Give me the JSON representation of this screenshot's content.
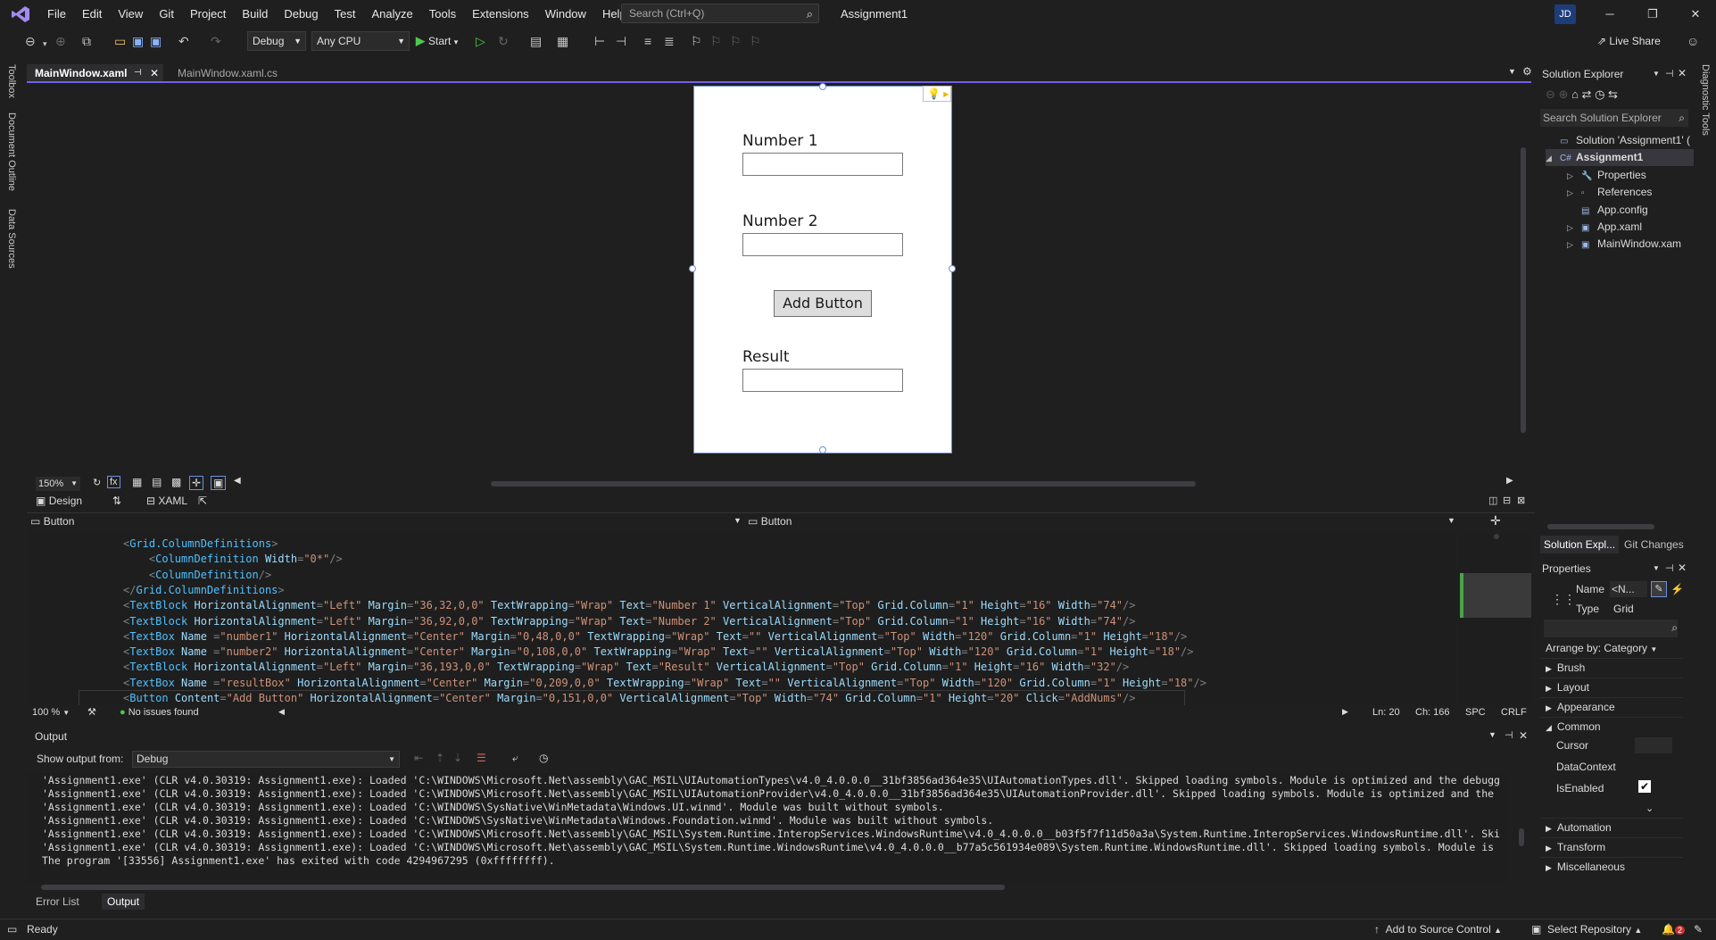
{
  "menubar": {
    "items": [
      "File",
      "Edit",
      "View",
      "Git",
      "Project",
      "Build",
      "Debug",
      "Test",
      "Analyze",
      "Tools",
      "Extensions",
      "Window",
      "Help"
    ],
    "search_placeholder": "Search (Ctrl+Q)",
    "window_title": "Assignment1",
    "user_initials": "JD"
  },
  "toolbar": {
    "config": "Debug",
    "platform": "Any CPU",
    "start_label": "Start",
    "live_share": "Live Share"
  },
  "left_rail": [
    "Toolbox",
    "Document Outline",
    "Data Sources"
  ],
  "right_rail": [
    "Diagnostic Tools"
  ],
  "tabs": [
    {
      "label": "MainWindow.xaml",
      "active": true
    },
    {
      "label": "MainWindow.xaml.cs",
      "active": false
    }
  ],
  "designer": {
    "number1_label": "Number 1",
    "number2_label": "Number 2",
    "button_label": "Add Button",
    "result_label": "Result",
    "zoom": "150%",
    "view_design": "Design",
    "view_xaml": "XAML",
    "breadcrumb_left": "Button",
    "breadcrumb_right": "Button"
  },
  "code_lines": [
    [
      [
        "p",
        "<"
      ],
      [
        "e",
        "Grid.ColumnDefinitions"
      ],
      [
        "p",
        ">"
      ]
    ],
    [
      [
        "p",
        "    <"
      ],
      [
        "e",
        "ColumnDefinition"
      ],
      [
        "a",
        " Width"
      ],
      [
        "p",
        "="
      ],
      [
        "v",
        "\"0*\""
      ],
      [
        "p",
        "/>"
      ]
    ],
    [
      [
        "p",
        "    <"
      ],
      [
        "e",
        "ColumnDefinition"
      ],
      [
        "p",
        "/>"
      ]
    ],
    [
      [
        "p",
        "</"
      ],
      [
        "e",
        "Grid.ColumnDefinitions"
      ],
      [
        "p",
        ">"
      ]
    ],
    [
      [
        "p",
        "<"
      ],
      [
        "e",
        "TextBlock"
      ],
      [
        "a",
        " HorizontalAlignment"
      ],
      [
        "p",
        "="
      ],
      [
        "v",
        "\"Left\""
      ],
      [
        "a",
        " Margin"
      ],
      [
        "p",
        "="
      ],
      [
        "v",
        "\"36,32,0,0\""
      ],
      [
        "a",
        " TextWrapping"
      ],
      [
        "p",
        "="
      ],
      [
        "v",
        "\"Wrap\""
      ],
      [
        "a",
        " Text"
      ],
      [
        "p",
        "="
      ],
      [
        "v",
        "\"Number 1\""
      ],
      [
        "a",
        " VerticalAlignment"
      ],
      [
        "p",
        "="
      ],
      [
        "v",
        "\"Top\""
      ],
      [
        "a",
        " Grid.Column"
      ],
      [
        "p",
        "="
      ],
      [
        "v",
        "\"1\""
      ],
      [
        "a",
        " Height"
      ],
      [
        "p",
        "="
      ],
      [
        "v",
        "\"16\""
      ],
      [
        "a",
        " Width"
      ],
      [
        "p",
        "="
      ],
      [
        "v",
        "\"74\""
      ],
      [
        "p",
        "/>"
      ]
    ],
    [
      [
        "p",
        "<"
      ],
      [
        "e",
        "TextBlock"
      ],
      [
        "a",
        " HorizontalAlignment"
      ],
      [
        "p",
        "="
      ],
      [
        "v",
        "\"Left\""
      ],
      [
        "a",
        " Margin"
      ],
      [
        "p",
        "="
      ],
      [
        "v",
        "\"36,92,0,0\""
      ],
      [
        "a",
        " TextWrapping"
      ],
      [
        "p",
        "="
      ],
      [
        "v",
        "\"Wrap\""
      ],
      [
        "a",
        " Text"
      ],
      [
        "p",
        "="
      ],
      [
        "v",
        "\"Number 2\""
      ],
      [
        "a",
        " VerticalAlignment"
      ],
      [
        "p",
        "="
      ],
      [
        "v",
        "\"Top\""
      ],
      [
        "a",
        " Grid.Column"
      ],
      [
        "p",
        "="
      ],
      [
        "v",
        "\"1\""
      ],
      [
        "a",
        " Height"
      ],
      [
        "p",
        "="
      ],
      [
        "v",
        "\"16\""
      ],
      [
        "a",
        " Width"
      ],
      [
        "p",
        "="
      ],
      [
        "v",
        "\"74\""
      ],
      [
        "p",
        "/>"
      ]
    ],
    [
      [
        "p",
        "<"
      ],
      [
        "e",
        "TextBox"
      ],
      [
        "a",
        " Name"
      ],
      [
        "p",
        " ="
      ],
      [
        "v",
        "\"number1\""
      ],
      [
        "a",
        " HorizontalAlignment"
      ],
      [
        "p",
        "="
      ],
      [
        "v",
        "\"Center\""
      ],
      [
        "a",
        " Margin"
      ],
      [
        "p",
        "="
      ],
      [
        "v",
        "\"0,48,0,0\""
      ],
      [
        "a",
        " TextWrapping"
      ],
      [
        "p",
        "="
      ],
      [
        "v",
        "\"Wrap\""
      ],
      [
        "a",
        " Text"
      ],
      [
        "p",
        "="
      ],
      [
        "v",
        "\"\""
      ],
      [
        "a",
        " VerticalAlignment"
      ],
      [
        "p",
        "="
      ],
      [
        "v",
        "\"Top\""
      ],
      [
        "a",
        " Width"
      ],
      [
        "p",
        "="
      ],
      [
        "v",
        "\"120\""
      ],
      [
        "a",
        " Grid.Column"
      ],
      [
        "p",
        "="
      ],
      [
        "v",
        "\"1\""
      ],
      [
        "a",
        " Height"
      ],
      [
        "p",
        "="
      ],
      [
        "v",
        "\"18\""
      ],
      [
        "p",
        "/>"
      ]
    ],
    [
      [
        "p",
        "<"
      ],
      [
        "e",
        "TextBox"
      ],
      [
        "a",
        " Name"
      ],
      [
        "p",
        " ="
      ],
      [
        "v",
        "\"number2\""
      ],
      [
        "a",
        " HorizontalAlignment"
      ],
      [
        "p",
        "="
      ],
      [
        "v",
        "\"Center\""
      ],
      [
        "a",
        " Margin"
      ],
      [
        "p",
        "="
      ],
      [
        "v",
        "\"0,108,0,0\""
      ],
      [
        "a",
        " TextWrapping"
      ],
      [
        "p",
        "="
      ],
      [
        "v",
        "\"Wrap\""
      ],
      [
        "a",
        " Text"
      ],
      [
        "p",
        "="
      ],
      [
        "v",
        "\"\""
      ],
      [
        "a",
        " VerticalAlignment"
      ],
      [
        "p",
        "="
      ],
      [
        "v",
        "\"Top\""
      ],
      [
        "a",
        " Width"
      ],
      [
        "p",
        "="
      ],
      [
        "v",
        "\"120\""
      ],
      [
        "a",
        " Grid.Column"
      ],
      [
        "p",
        "="
      ],
      [
        "v",
        "\"1\""
      ],
      [
        "a",
        " Height"
      ],
      [
        "p",
        "="
      ],
      [
        "v",
        "\"18\""
      ],
      [
        "p",
        "/>"
      ]
    ],
    [
      [
        "p",
        "<"
      ],
      [
        "e",
        "TextBlock"
      ],
      [
        "a",
        " HorizontalAlignment"
      ],
      [
        "p",
        "="
      ],
      [
        "v",
        "\"Left\""
      ],
      [
        "a",
        " Margin"
      ],
      [
        "p",
        "="
      ],
      [
        "v",
        "\"36,193,0,0\""
      ],
      [
        "a",
        " TextWrapping"
      ],
      [
        "p",
        "="
      ],
      [
        "v",
        "\"Wrap\""
      ],
      [
        "a",
        " Text"
      ],
      [
        "p",
        "="
      ],
      [
        "v",
        "\"Result\""
      ],
      [
        "a",
        " VerticalAlignment"
      ],
      [
        "p",
        "="
      ],
      [
        "v",
        "\"Top\""
      ],
      [
        "a",
        " Grid.Column"
      ],
      [
        "p",
        "="
      ],
      [
        "v",
        "\"1\""
      ],
      [
        "a",
        " Height"
      ],
      [
        "p",
        "="
      ],
      [
        "v",
        "\"16\""
      ],
      [
        "a",
        " Width"
      ],
      [
        "p",
        "="
      ],
      [
        "v",
        "\"32\""
      ],
      [
        "p",
        "/>"
      ]
    ],
    [
      [
        "p",
        "<"
      ],
      [
        "e",
        "TextBox"
      ],
      [
        "a",
        " Name"
      ],
      [
        "p",
        " ="
      ],
      [
        "v",
        "\"resultBox\""
      ],
      [
        "a",
        " HorizontalAlignment"
      ],
      [
        "p",
        "="
      ],
      [
        "v",
        "\"Center\""
      ],
      [
        "a",
        " Margin"
      ],
      [
        "p",
        "="
      ],
      [
        "v",
        "\"0,209,0,0\""
      ],
      [
        "a",
        " TextWrapping"
      ],
      [
        "p",
        "="
      ],
      [
        "v",
        "\"Wrap\""
      ],
      [
        "a",
        " Text"
      ],
      [
        "p",
        "="
      ],
      [
        "v",
        "\"\""
      ],
      [
        "a",
        " VerticalAlignment"
      ],
      [
        "p",
        "="
      ],
      [
        "v",
        "\"Top\""
      ],
      [
        "a",
        " Width"
      ],
      [
        "p",
        "="
      ],
      [
        "v",
        "\"120\""
      ],
      [
        "a",
        " Grid.Column"
      ],
      [
        "p",
        "="
      ],
      [
        "v",
        "\"1\""
      ],
      [
        "a",
        " Height"
      ],
      [
        "p",
        "="
      ],
      [
        "v",
        "\"18\""
      ],
      [
        "p",
        "/>"
      ]
    ],
    [
      [
        "p",
        "<"
      ],
      [
        "e",
        "Button"
      ],
      [
        "a",
        " Content"
      ],
      [
        "p",
        "="
      ],
      [
        "v",
        "\"Add Button\""
      ],
      [
        "a",
        " HorizontalAlignment"
      ],
      [
        "p",
        "="
      ],
      [
        "v",
        "\"Center\""
      ],
      [
        "a",
        " Margin"
      ],
      [
        "p",
        "="
      ],
      [
        "v",
        "\"0,151,0,0\""
      ],
      [
        "a",
        " VerticalAlignment"
      ],
      [
        "p",
        "="
      ],
      [
        "v",
        "\"Top\""
      ],
      [
        "a",
        " Width"
      ],
      [
        "p",
        "="
      ],
      [
        "v",
        "\"74\""
      ],
      [
        "a",
        " Grid.Column"
      ],
      [
        "p",
        "="
      ],
      [
        "v",
        "\"1\""
      ],
      [
        "a",
        " Height"
      ],
      [
        "p",
        "="
      ],
      [
        "v",
        "\"20\""
      ],
      [
        "a",
        " Click"
      ],
      [
        "p",
        "="
      ],
      [
        "v",
        "\"AddNums\""
      ],
      [
        "p",
        "/>"
      ]
    ]
  ],
  "code_status": {
    "zoom": "100 %",
    "issues": "No issues found",
    "line": "Ln: 20",
    "col": "Ch: 166",
    "spc": "SPC",
    "eol": "CRLF"
  },
  "output": {
    "title": "Output",
    "show_from_label": "Show output from:",
    "source": "Debug",
    "lines": [
      "'Assignment1.exe' (CLR v4.0.30319: Assignment1.exe): Loaded 'C:\\WINDOWS\\Microsoft.Net\\assembly\\GAC_MSIL\\UIAutomationTypes\\v4.0_4.0.0.0__31bf3856ad364e35\\UIAutomationTypes.dll'. Skipped loading symbols. Module is optimized and the debugg",
      "'Assignment1.exe' (CLR v4.0.30319: Assignment1.exe): Loaded 'C:\\WINDOWS\\Microsoft.Net\\assembly\\GAC_MSIL\\UIAutomationProvider\\v4.0_4.0.0.0__31bf3856ad364e35\\UIAutomationProvider.dll'. Skipped loading symbols. Module is optimized and the",
      "'Assignment1.exe' (CLR v4.0.30319: Assignment1.exe): Loaded 'C:\\WINDOWS\\SysNative\\WinMetadata\\Windows.UI.winmd'. Module was built without symbols.",
      "'Assignment1.exe' (CLR v4.0.30319: Assignment1.exe): Loaded 'C:\\WINDOWS\\SysNative\\WinMetadata\\Windows.Foundation.winmd'. Module was built without symbols.",
      "'Assignment1.exe' (CLR v4.0.30319: Assignment1.exe): Loaded 'C:\\WINDOWS\\Microsoft.Net\\assembly\\GAC_MSIL\\System.Runtime.InteropServices.WindowsRuntime\\v4.0_4.0.0.0__b03f5f7f11d50a3a\\System.Runtime.InteropServices.WindowsRuntime.dll'. Ski",
      "'Assignment1.exe' (CLR v4.0.30319: Assignment1.exe): Loaded 'C:\\WINDOWS\\Microsoft.Net\\assembly\\GAC_MSIL\\System.Runtime.WindowsRuntime\\v4.0_4.0.0.0__b77a5c561934e089\\System.Runtime.WindowsRuntime.dll'. Skipped loading symbols. Module is",
      "The program '[33556] Assignment1.exe' has exited with code 4294967295 (0xffffffff)."
    ],
    "tabs": [
      "Error List",
      "Output"
    ]
  },
  "solution_explorer": {
    "title": "Solution Explorer",
    "search_placeholder": "Search Solution Explorer",
    "items": [
      {
        "label": "Solution 'Assignment1' (",
        "icon": "solution-icon",
        "bold": false
      },
      {
        "label": "Assignment1",
        "icon": "csharp-project-icon",
        "bold": true
      },
      {
        "label": "Properties",
        "icon": "wrench-icon",
        "bold": false
      },
      {
        "label": "References",
        "icon": "references-icon",
        "bold": false
      },
      {
        "label": "App.config",
        "icon": "config-file-icon",
        "bold": false
      },
      {
        "label": "App.xaml",
        "icon": "xaml-file-icon",
        "bold": false
      },
      {
        "label": "MainWindow.xam",
        "icon": "xaml-file-icon",
        "bold": false
      }
    ],
    "bottom_tabs": [
      "Solution Expl...",
      "Git Changes"
    ]
  },
  "properties": {
    "title": "Properties",
    "name_label": "Name",
    "name_value": "<N...",
    "type_label": "Type",
    "type_value": "Grid",
    "arrange_by": "Arrange by: Category",
    "categories": [
      "Brush",
      "Layout",
      "Appearance",
      "Common",
      "Automation",
      "Transform",
      "Miscellaneous"
    ],
    "common_props": [
      "Cursor",
      "DataContext",
      "IsEnabled"
    ]
  },
  "status": {
    "ready": "Ready",
    "add_source_control": "Add to Source Control",
    "select_repo": "Select Repository",
    "notification_count": "2"
  },
  "colors": {
    "accent": "#7160e8",
    "background": "#1f1f1f",
    "editor": "#1e1e1e"
  }
}
